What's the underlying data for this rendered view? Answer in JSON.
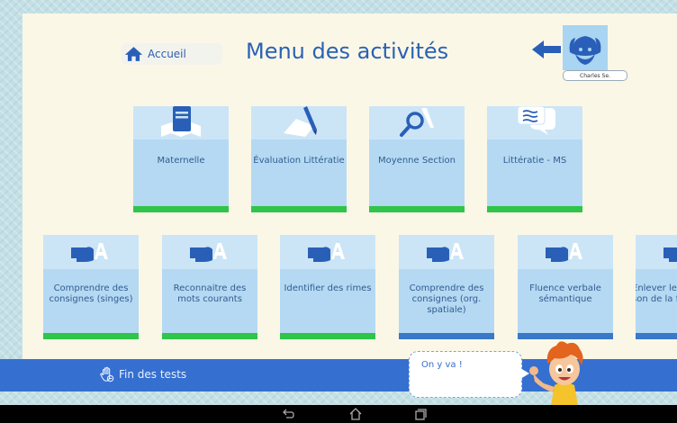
{
  "header": {
    "home_label": "Accueil",
    "title": "Menu des activités",
    "profile_name": "Charles Se."
  },
  "top_tiles": [
    {
      "label": "Maternelle",
      "icon": "book-icon"
    },
    {
      "label": "Évaluation Littératie",
      "icon": "pencil-paper-icon"
    },
    {
      "label": "Moyenne Section",
      "icon": "magnifier-icon"
    },
    {
      "label": "Littératie - MS",
      "icon": "speech-bubbles-icon"
    }
  ],
  "bottom_tiles": [
    {
      "label": "Comprendre des consignes (singes)",
      "icon": "pointing-hand-icon"
    },
    {
      "label": "Reconnaitre des mots courants",
      "icon": "pointing-hand-icon"
    },
    {
      "label": "Identifier des rimes",
      "icon": "pointing-hand-icon"
    },
    {
      "label": "Comprendre des consignes (org. spatiale)",
      "icon": "pointing-hand-icon"
    },
    {
      "label": "Fluence verbale sémantique",
      "icon": "pointing-hand-icon"
    },
    {
      "label": "Enlever le son de la fin",
      "icon": "pointing-hand-icon"
    }
  ],
  "footer": {
    "end_tests_label": "Fin des tests",
    "speech_text": "On y va !"
  },
  "colors": {
    "accent": "#2a62b4",
    "tile": "#b5d9f2",
    "progress_green": "#2fc44a",
    "bottom_bar": "#356fd0"
  }
}
